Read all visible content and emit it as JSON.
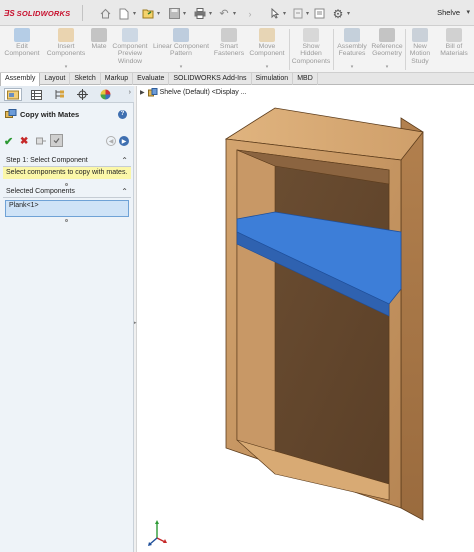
{
  "app": {
    "brand": "SOLIDWORKS",
    "document_title": "Shelve"
  },
  "ribbon": [
    {
      "label": "Edit\nComponent",
      "icon": "edit-component-icon"
    },
    {
      "label": "Insert\nComponents",
      "icon": "insert-components-icon"
    },
    {
      "label": "Mate",
      "icon": "mate-icon"
    },
    {
      "label": "Component\nPreview\nWindow",
      "icon": "preview-window-icon"
    },
    {
      "label": "Linear Component\nPattern",
      "icon": "linear-pattern-icon"
    },
    {
      "label": "Smart\nFasteners",
      "icon": "smart-fasteners-icon"
    },
    {
      "label": "Move\nComponent",
      "icon": "move-component-icon"
    },
    {
      "label": "Show\nHidden\nComponents",
      "icon": "show-hidden-icon"
    },
    {
      "label": "Assembly\nFeatures",
      "icon": "assembly-features-icon"
    },
    {
      "label": "Reference\nGeometry",
      "icon": "reference-geometry-icon"
    },
    {
      "label": "New\nMotion\nStudy",
      "icon": "motion-study-icon"
    },
    {
      "label": "Bill of\nMaterials",
      "icon": "bom-icon"
    }
  ],
  "tabs": [
    "Assembly",
    "Layout",
    "Sketch",
    "Markup",
    "Evaluate",
    "SOLIDWORKS Add-Ins",
    "Simulation",
    "MBD"
  ],
  "active_tab": "Assembly",
  "property_manager": {
    "title": "Copy with Mates",
    "step1": {
      "header": "Step 1: Select Component",
      "message": "Select components to copy with mates."
    },
    "selected": {
      "header": "Selected Components",
      "items": [
        "Plank<1>"
      ]
    }
  },
  "viewport": {
    "tree_label": "Shelve (Default) <Display ..."
  },
  "colors": {
    "accent": "#3f6fb0",
    "selection": "#cfe3f7",
    "message_bg": "#fbf7a9",
    "shelf_plank_selected": "#3d7ed8",
    "wood": "#b98a58"
  }
}
